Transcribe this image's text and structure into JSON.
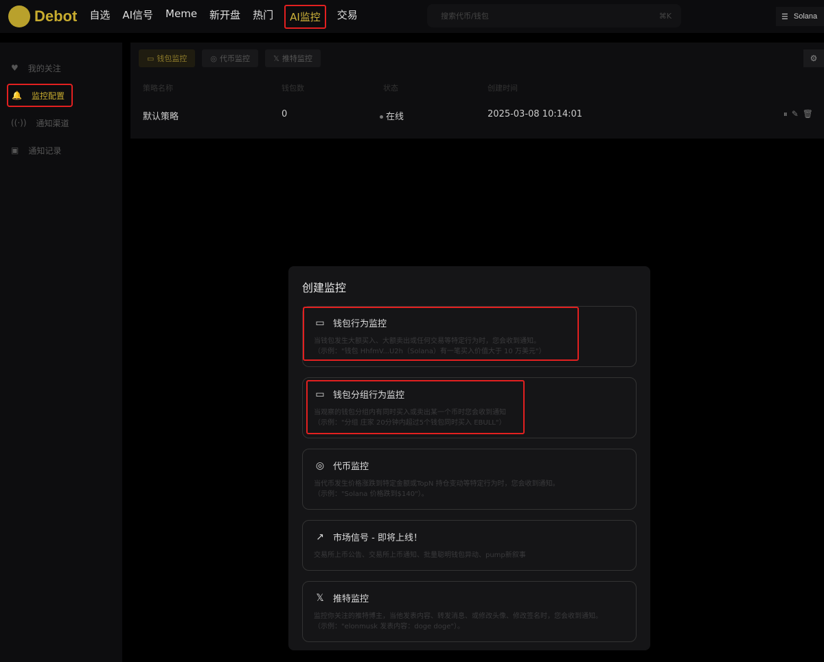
{
  "header": {
    "logo": "Debot",
    "nav": [
      "自选",
      "AI信号",
      "Meme",
      "新开盘",
      "热门",
      "AI监控",
      "交易"
    ],
    "active_nav": "AI监控",
    "search_placeholder": "搜索代币/钱包",
    "search_shortcut": "⌘K",
    "chain": "Solana"
  },
  "sidebar": {
    "items": [
      {
        "label": "我的关注",
        "icon": "heart-icon"
      },
      {
        "label": "监控配置",
        "icon": "bell-icon",
        "active": true
      },
      {
        "label": "通知渠道",
        "icon": "broadcast-icon"
      },
      {
        "label": "通知记录",
        "icon": "file-icon"
      }
    ]
  },
  "main": {
    "tabs": [
      {
        "label": "钱包监控",
        "active": true
      },
      {
        "label": "代币监控"
      },
      {
        "label": "推特监控"
      }
    ],
    "columns": [
      "策略名称",
      "钱包数",
      "状态",
      "创建时间"
    ],
    "rows": [
      {
        "name": "默认策略",
        "wallets": "0",
        "status": "在线",
        "created": "2025-03-08 10:14:01"
      }
    ]
  },
  "modal": {
    "title": "创建监控",
    "options": [
      {
        "title": "钱包行为监控",
        "icon": "wallet-icon",
        "desc1": "当钱包发生大额买入、大额卖出或任何交易等特定行为时，您会收到通知。",
        "desc2": "（示例：\"钱包 HhfmV...U2h（Solana）有一笔买入价值大于 10 万美元\"）"
      },
      {
        "title": "钱包分组行为监控",
        "icon": "wallet-icon",
        "desc1": "当观察的钱包分组内有同时买入或卖出某一个币时您会收到通知",
        "desc2": "（示例：\"分组 庄家 20分钟内超过5个钱包同时买入 EBULL\"）"
      },
      {
        "title": "代币监控",
        "icon": "token-icon",
        "desc1": "当代币发生价格涨跌到特定金额或TopN 持仓变动等特定行为时，您会收到通知。",
        "desc2": "（示例：\"Solana 价格跌到$140\"）。"
      },
      {
        "title": "市场信号 - 即将上线！",
        "icon": "trending-up-icon",
        "desc1": "交易所上币公告、交易所上币通知、批量聪明钱包异动、pump新叙事",
        "desc2": ""
      },
      {
        "title": "推特监控",
        "icon": "x-icon",
        "desc1": "监控你关注的推特博主，当他发表内容、转发消息、或修改头像、修改签名时，您会收到通知。",
        "desc2": "（示例：\"elonmusk 发表内容：doge doge\"）。"
      }
    ]
  },
  "colors": {
    "accent": "#c8ac2f",
    "highlight_box": "#e32020"
  }
}
